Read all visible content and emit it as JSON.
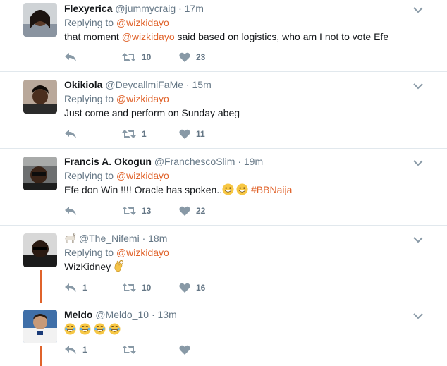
{
  "colors": {
    "accent": "#e0632b",
    "muted": "#657786",
    "text": "#14171a",
    "divider": "#e1e8ed"
  },
  "tweets": [
    {
      "name": "Flexyerica",
      "handle": "@jummycraig",
      "dot": "·",
      "time": "17m",
      "replying_label": "Replying to",
      "replying_to": "@wizkidayo",
      "text_before": "that moment ",
      "mention": "@wizkidayo",
      "text_after": " said based on logistics, who am I not to vote Efe",
      "reply_count": "",
      "retweet_count": "10",
      "like_count": "23"
    },
    {
      "name": "Okikiola",
      "handle": "@DeycallmiFaMe",
      "dot": "·",
      "time": "15m",
      "replying_label": "Replying to",
      "replying_to": "@wizkidayo",
      "text": "Just come and perform on Sunday abeg",
      "reply_count": "",
      "retweet_count": "1",
      "like_count": "11"
    },
    {
      "name": "Francis A. Okogun",
      "handle": "@FranchescoSlim",
      "dot": "·",
      "time": "19m",
      "replying_label": "Replying to",
      "replying_to": "@wizkidayo",
      "text": "Efe don Win !!!! Oracle has spoken..",
      "emojis": [
        "grinning-face",
        "grinning-face"
      ],
      "hashtag": "#BBNaija",
      "reply_count": "",
      "retweet_count": "13",
      "like_count": "22"
    },
    {
      "name_emoji": "goat",
      "handle": "@The_Nifemi",
      "dot": "·",
      "time": "18m",
      "replying_label": "Replying to",
      "replying_to": "@wizkidayo",
      "text": "WizKidney",
      "emojis": [
        "ok-hand"
      ],
      "reply_count": "1",
      "retweet_count": "10",
      "like_count": "16"
    },
    {
      "name": "Meldo",
      "handle": "@Meldo_10",
      "dot": "·",
      "time": "13m",
      "emojis": [
        "tears-of-joy",
        "tears-of-joy",
        "tears-of-joy",
        "tears-of-joy"
      ],
      "reply_count": "1",
      "retweet_count": "",
      "like_count": ""
    }
  ]
}
